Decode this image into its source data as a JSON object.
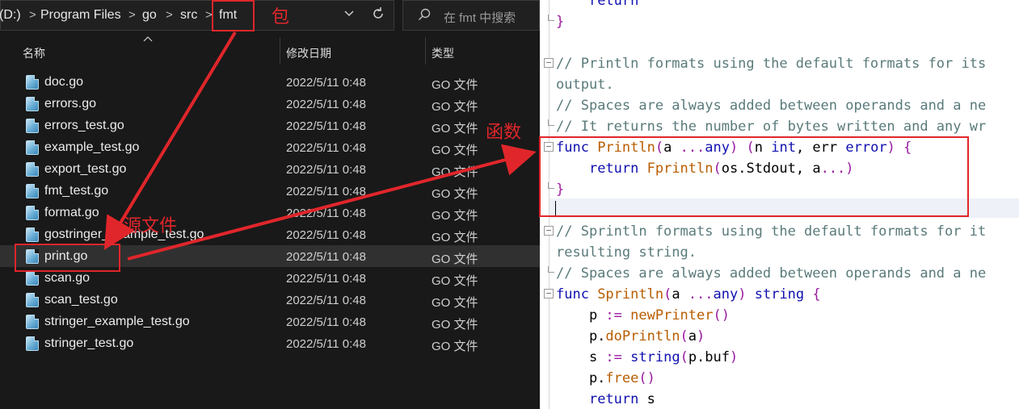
{
  "explorer": {
    "breadcrumb": [
      "(D:)",
      "Program Files",
      "go",
      "src",
      "fmt"
    ],
    "separator": ">",
    "dropdown_icon": "chevron-down-icon",
    "refresh_icon": "refresh-icon",
    "search_placeholder": "在 fmt 中搜索",
    "columns": {
      "name": "名称",
      "modified": "修改日期",
      "type": "类型"
    },
    "files": [
      {
        "name": "doc.go",
        "modified": "2022/5/11 0:48",
        "type": "GO 文件"
      },
      {
        "name": "errors.go",
        "modified": "2022/5/11 0:48",
        "type": "GO 文件"
      },
      {
        "name": "errors_test.go",
        "modified": "2022/5/11 0:48",
        "type": "GO 文件"
      },
      {
        "name": "example_test.go",
        "modified": "2022/5/11 0:48",
        "type": "GO 文件"
      },
      {
        "name": "export_test.go",
        "modified": "2022/5/11 0:48",
        "type": "GO 文件"
      },
      {
        "name": "fmt_test.go",
        "modified": "2022/5/11 0:48",
        "type": "GO 文件"
      },
      {
        "name": "format.go",
        "modified": "2022/5/11 0:48",
        "type": "GO 文件"
      },
      {
        "name": "gostringer_example_test.go",
        "modified": "2022/5/11 0:48",
        "type": "GO 文件"
      },
      {
        "name": "print.go",
        "modified": "2022/5/11 0:48",
        "type": "GO 文件",
        "selected": true
      },
      {
        "name": "scan.go",
        "modified": "2022/5/11 0:48",
        "type": "GO 文件"
      },
      {
        "name": "scan_test.go",
        "modified": "2022/5/11 0:48",
        "type": "GO 文件"
      },
      {
        "name": "stringer_example_test.go",
        "modified": "2022/5/11 0:48",
        "type": "GO 文件"
      },
      {
        "name": "stringer_test.go",
        "modified": "2022/5/11 0:48",
        "type": "GO 文件"
      }
    ]
  },
  "code": {
    "lines": [
      [
        [
          "    ",
          "pl"
        ],
        [
          "return",
          "kw"
        ]
      ],
      [
        [
          "}",
          "br"
        ]
      ],
      [],
      [
        [
          "// Println formats using the default formats for its",
          "cm"
        ]
      ],
      [
        [
          "output.",
          "cm"
        ]
      ],
      [
        [
          "// Spaces are always added between operands and a ne",
          "cm"
        ]
      ],
      [
        [
          "// It returns the number of bytes written and any wr",
          "cm"
        ]
      ],
      [
        [
          "func ",
          "kw"
        ],
        [
          "Println",
          "fn"
        ],
        [
          "(",
          "br"
        ],
        [
          "a ",
          "pl"
        ],
        [
          "...",
          "br"
        ],
        [
          "any",
          "kw"
        ],
        [
          ") (",
          "br"
        ],
        [
          "n ",
          "pl"
        ],
        [
          "int",
          "kw"
        ],
        [
          ", ",
          "pl"
        ],
        [
          "err ",
          "pl"
        ],
        [
          "error",
          "kw"
        ],
        [
          ") {",
          "br"
        ]
      ],
      [
        [
          "    ",
          "pl"
        ],
        [
          "return ",
          "kw"
        ],
        [
          "Fprintln",
          "fn"
        ],
        [
          "(",
          "br"
        ],
        [
          "os.Stdout, a",
          "pl"
        ],
        [
          "...)",
          "br"
        ]
      ],
      [
        [
          "}",
          "br"
        ]
      ],
      [],
      [
        [
          "// Sprintln formats using the default formats for it",
          "cm"
        ]
      ],
      [
        [
          "resulting string.",
          "cm"
        ]
      ],
      [
        [
          "// Spaces are always added between operands and a ne",
          "cm"
        ]
      ],
      [
        [
          "func ",
          "kw"
        ],
        [
          "Sprintln",
          "fn"
        ],
        [
          "(",
          "br"
        ],
        [
          "a ",
          "pl"
        ],
        [
          "...",
          "br"
        ],
        [
          "any",
          "kw"
        ],
        [
          ") ",
          "br"
        ],
        [
          "string ",
          "kw"
        ],
        [
          "{",
          "br"
        ]
      ],
      [
        [
          "    p ",
          "pl"
        ],
        [
          ":= ",
          "br"
        ],
        [
          "newPrinter",
          "fn"
        ],
        [
          "()",
          "br"
        ]
      ],
      [
        [
          "    p.",
          "pl"
        ],
        [
          "doPrintln",
          "fn"
        ],
        [
          "(",
          "br"
        ],
        [
          "a",
          "pl"
        ],
        [
          ")",
          "br"
        ]
      ],
      [
        [
          "    s ",
          "pl"
        ],
        [
          ":= ",
          "br"
        ],
        [
          "string",
          "kw"
        ],
        [
          "(",
          "br"
        ],
        [
          "p.buf",
          "pl"
        ],
        [
          ")",
          "br"
        ]
      ],
      [
        [
          "    p.",
          "pl"
        ],
        [
          "free",
          "fn"
        ],
        [
          "()",
          "br"
        ]
      ],
      [
        [
          "    ",
          "pl"
        ],
        [
          "return ",
          "kw"
        ],
        [
          "s",
          "pl"
        ]
      ]
    ]
  },
  "annotations": {
    "package_label": "包",
    "source_label": "源文件",
    "function_label": "函数",
    "accent": "#e0262b"
  }
}
